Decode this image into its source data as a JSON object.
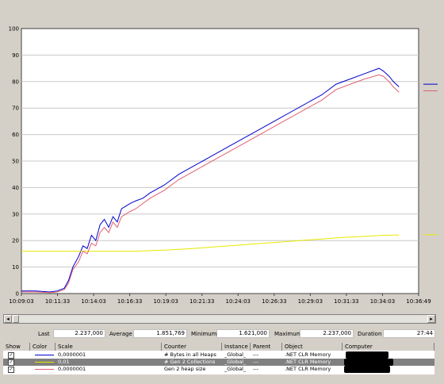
{
  "chart_data": {
    "type": "line",
    "ylim": [
      0,
      100
    ],
    "yticks": [
      "0",
      "10",
      "20",
      "30",
      "40",
      "50",
      "60",
      "70",
      "80",
      "90",
      "100"
    ],
    "xticks": [
      "10:09:03",
      "10:11:33",
      "10:14:03",
      "10:16:33",
      "10:19:03",
      "10:21:33",
      "10:24:03",
      "10:26:33",
      "10:29:03",
      "10:31:33",
      "10:34:03",
      "10:36:49"
    ],
    "grid": "horizontal",
    "x_minutes": [
      0,
      1,
      2,
      2.5,
      3,
      3.3,
      3.6,
      4,
      4.3,
      4.6,
      4.9,
      5.2,
      5.5,
      5.8,
      6.1,
      6.4,
      6.7,
      7,
      7.3,
      7.6,
      8,
      8.5,
      9,
      10,
      11,
      12,
      13,
      14,
      15,
      16,
      17,
      18,
      19,
      20,
      21,
      22,
      23,
      24,
      25,
      25.3,
      25.7,
      26,
      26.4
    ],
    "series": [
      {
        "name": "# Bytes in all Heaps",
        "color": "#0000cc",
        "values": [
          1,
          1,
          0.6,
          1,
          2,
          5,
          10,
          14,
          18,
          17,
          22,
          20,
          26,
          28,
          25,
          29,
          27,
          32,
          33,
          34,
          35,
          36,
          38,
          41,
          45,
          48,
          51,
          54,
          57,
          60,
          63,
          66,
          69,
          72,
          75,
          79,
          81,
          83,
          85,
          84,
          82,
          80,
          78
        ]
      },
      {
        "name": "# Gen 2 Collections",
        "color": "#e8e800",
        "values": [
          16,
          16,
          16,
          16,
          16,
          16,
          16,
          16,
          16,
          16,
          16,
          16,
          16,
          16,
          16,
          16,
          16,
          16,
          16,
          16,
          16,
          16.1,
          16.2,
          16.4,
          16.7,
          17,
          17.4,
          17.8,
          18.2,
          18.6,
          19,
          19.4,
          19.8,
          20.2,
          20.6,
          21,
          21.3,
          21.6,
          21.9,
          22,
          22,
          22.1,
          22.1
        ]
      },
      {
        "name": "Gen 2 heap size",
        "color": "#e06070",
        "values": [
          0.6,
          0.6,
          0.4,
          0.6,
          1.5,
          4,
          9,
          12,
          16,
          15,
          19,
          18,
          23,
          25,
          23,
          27,
          25,
          29,
          30,
          31,
          32,
          34,
          36,
          39,
          43,
          46,
          49,
          52,
          55,
          58,
          61,
          64,
          67,
          70,
          73,
          77,
          79,
          81,
          82.5,
          82,
          80,
          78,
          76
        ]
      }
    ],
    "right_markers": [
      {
        "series": "# Bytes in all Heaps",
        "value": 79
      },
      {
        "series": "Gen 2 heap size",
        "value": 76.5
      },
      {
        "series": "# Gen 2 Collections",
        "value": 22.2
      }
    ]
  },
  "stats": {
    "last_label": "Last",
    "last_value": "2.237,000",
    "average_label": "Average",
    "average_value": "1.851,769",
    "minimum_label": "Minimum",
    "minimum_value": "1.621,000",
    "maximum_label": "Maximum",
    "maximum_value": "2.237,000",
    "duration_label": "Duration",
    "duration_value": "27:44"
  },
  "legend": {
    "headers": {
      "show": "Show",
      "color": "Color",
      "scale": "Scale",
      "counter": "Counter",
      "instance": "Instance",
      "parent": "Parent",
      "object": "Object",
      "computer": "Computer"
    },
    "rows": [
      {
        "scale": "0,0000001",
        "counter": "# Bytes in all Heaps",
        "instance": "_Global_",
        "parent": "---",
        "object": ".NET CLR Memory",
        "color": "#0000cc",
        "checked": "✓"
      },
      {
        "scale": "0,01",
        "counter": "# Gen 2 Collections",
        "instance": "_Global_",
        "parent": "---",
        "object": ".NET CLR Memory",
        "color": "#e8e800",
        "checked": "✓"
      },
      {
        "scale": "0,0000001",
        "counter": "Gen 2 heap size",
        "instance": "_Global_",
        "parent": "---",
        "object": ".NET CLR Memory",
        "color": "#e06070",
        "checked": "✓"
      }
    ]
  },
  "scrollbar": {
    "left_arrow": "◂",
    "right_arrow": "▸"
  }
}
